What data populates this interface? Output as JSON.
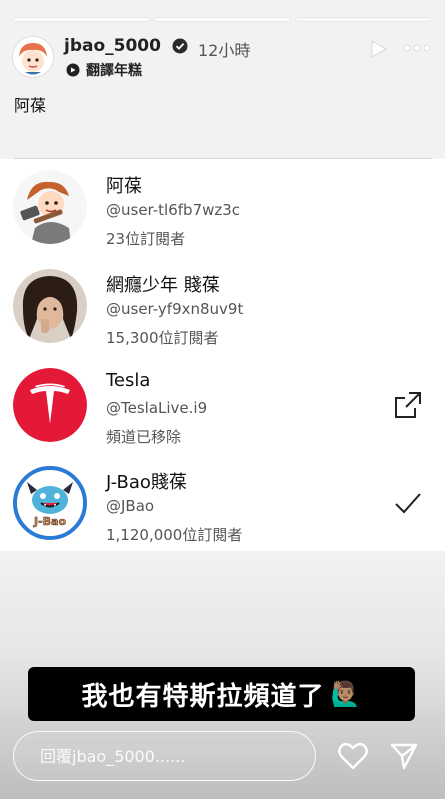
{
  "story": {
    "progress_total": 3,
    "progress_done": 2,
    "username": "jbao_5000",
    "time_ago": "12小時",
    "sub_label": "翻譯年糕",
    "body_text": "阿葆"
  },
  "channels": [
    {
      "name": "阿葆",
      "handle": "@user-tl6fb7wz3c",
      "subs": "23位訂閱者",
      "avatar": "cartoon-avatar",
      "action": ""
    },
    {
      "name": "網癮少年 賤葆",
      "handle": "@user-yf9xn8uv9t",
      "subs": "15,300位訂閱者",
      "avatar": "photo-avatar",
      "action": ""
    },
    {
      "name": "Tesla",
      "handle": "@TeslaLive.i9",
      "subs": "頻道已移除",
      "avatar": "tesla-logo",
      "action": "open-external-icon"
    },
    {
      "name": "J-Bao賤葆",
      "handle": "@JBao",
      "subs": "1,120,000位訂閱者",
      "avatar": "jbao-monster-logo",
      "action": "checkmark-icon"
    }
  ],
  "jbao_logo_text": "J-Bao",
  "caption": {
    "text": "我也有特斯拉頻道了",
    "emoji": "🙋🏽‍♂️"
  },
  "reply": {
    "placeholder": "回覆jbao_5000......"
  },
  "colors": {
    "tesla_red": "#e31937",
    "jbao_blue": "#2a7bd6"
  }
}
